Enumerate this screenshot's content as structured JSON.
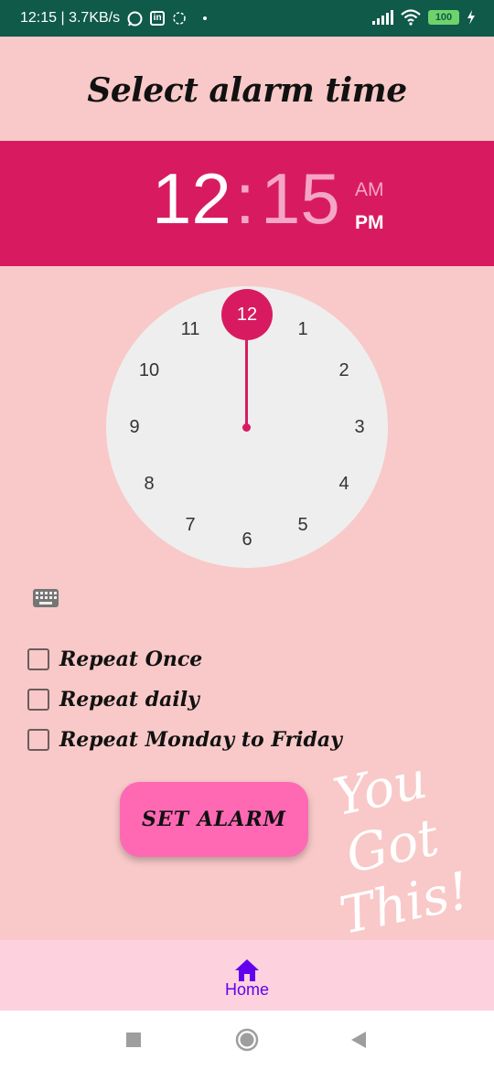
{
  "status_bar": {
    "left_text": "12:15 | 3.7KB/s",
    "battery": "100"
  },
  "page_title": "Select alarm time",
  "time_display": {
    "hour": "12",
    "separator": ":",
    "minute": "15",
    "am": "AM",
    "pm": "PM"
  },
  "clock": {
    "selected": "12",
    "numbers": [
      "1",
      "2",
      "3",
      "4",
      "5",
      "6",
      "7",
      "8",
      "9",
      "10",
      "11"
    ]
  },
  "repeat_options": [
    {
      "label": "Repeat Once",
      "checked": false
    },
    {
      "label": "Repeat daily",
      "checked": false
    },
    {
      "label": "Repeat Monday to Friday",
      "checked": false
    }
  ],
  "set_alarm_label": "SET ALARM",
  "decoration_text": "You Got This!",
  "bottom_nav": {
    "home_label": "Home"
  },
  "colors": {
    "background": "#f8c9c8",
    "accent": "#d81b60",
    "button": "#ff69b4",
    "status_bar": "#0f5a49",
    "nav_selected": "#6200ee"
  }
}
